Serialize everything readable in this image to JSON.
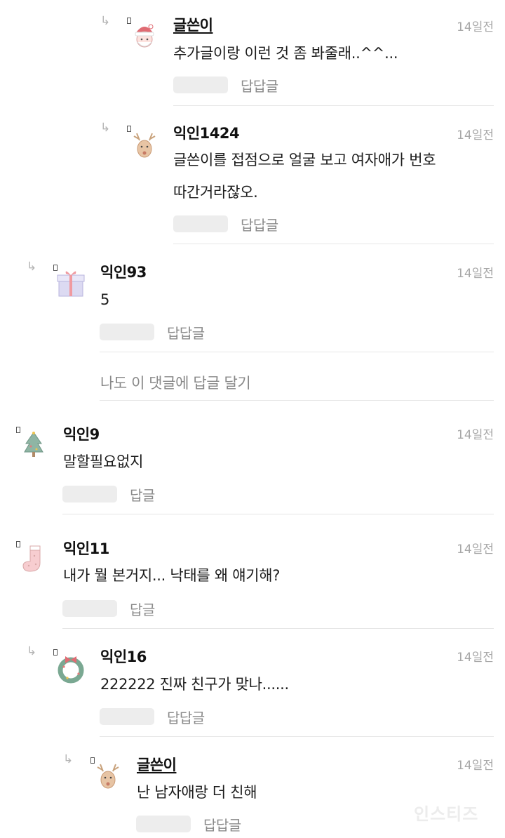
{
  "comments": [
    {
      "name": "글쓴이",
      "time": "14일전",
      "text": "추가글이랑 이런 것 좀 봐줄래..^^...",
      "reply": "답답글"
    },
    {
      "name": "익인1424",
      "time": "14일전",
      "text_line1": "글쓴이를 접점으로 얼굴 보고 여자애가 번호",
      "text_line2": "따간거라잖오.",
      "reply": "답답글"
    },
    {
      "name": "익인93",
      "time": "14일전",
      "text": "5",
      "reply": "답답글"
    },
    {
      "name": "익인9",
      "time": "14일전",
      "text": "말할필요없지",
      "reply": "답글"
    },
    {
      "name": "익인11",
      "time": "14일전",
      "text": "내가 뭘 본거지... 낙태를 왜 얘기해?",
      "reply": "답글"
    },
    {
      "name": "익인16",
      "time": "14일전",
      "text": "222222 진짜 친구가 맞나......",
      "reply": "답답글"
    },
    {
      "name": "글쓴이",
      "time": "14일전",
      "text": "난 남자애랑 더 친해",
      "reply": "답답글"
    }
  ],
  "write_reply": "나도 이 댓글에 답글 달기",
  "watermark": "인스티즈",
  "icons": {
    "reply_arrow": "reply-arrow-icon"
  },
  "colors": {
    "meta": "#a7a7a7",
    "pill": "#ededed",
    "divider": "#e6e6e6"
  }
}
